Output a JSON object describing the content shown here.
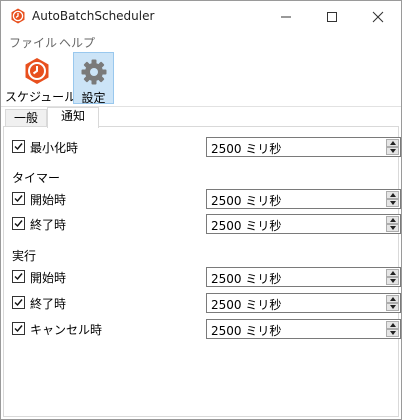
{
  "window": {
    "title": "AutoBatchScheduler"
  },
  "menu": {
    "items": [
      "ファイル",
      "ヘルプ"
    ]
  },
  "toolbar": {
    "schedule_label": "スケジュール",
    "settings_label": "設定"
  },
  "tabs": {
    "general": "一般",
    "notify": "通知"
  },
  "minimize_row": {
    "label": "最小化時",
    "checked": true,
    "value": "2500 ミリ秒"
  },
  "timer": {
    "title": "タイマー",
    "rows": [
      {
        "label": "開始時",
        "checked": true,
        "value": "2500 ミリ秒"
      },
      {
        "label": "終了時",
        "checked": true,
        "value": "2500 ミリ秒"
      }
    ]
  },
  "exec": {
    "title": "実行",
    "rows": [
      {
        "label": "開始時",
        "checked": true,
        "value": "2500 ミリ秒"
      },
      {
        "label": "終了時",
        "checked": true,
        "value": "2500 ミリ秒"
      },
      {
        "label": "キャンセル時",
        "checked": true,
        "value": "2500 ミリ秒"
      }
    ]
  },
  "colors": {
    "accent": "#cce4f7",
    "icon_orange": "#e8501e",
    "icon_gray": "#7a7a7a"
  },
  "icons": {
    "app": "clock-icon",
    "schedule": "clock-icon",
    "settings": "gear-icon"
  }
}
